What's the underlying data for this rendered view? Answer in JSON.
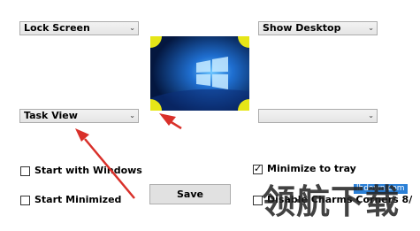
{
  "dropdowns": {
    "top_left": "Lock Screen",
    "top_right": "Show Desktop",
    "bottom_left": "Task View",
    "bottom_right": ""
  },
  "checkboxes": {
    "start_with_windows": {
      "label": "Start with Windows",
      "checked": false
    },
    "start_minimized": {
      "label": "Start Minimized",
      "checked": false
    },
    "minimize_to_tray": {
      "label": "Minimize to tray",
      "checked": true
    },
    "disable_charms": {
      "label": "Disable Charms Corners 8/",
      "checked": false
    }
  },
  "save_button": "Save",
  "watermark": {
    "url": "lhdown.com",
    "text": "领航下载"
  },
  "colors": {
    "corner": "#e6e617",
    "arrow": "#d9302a",
    "desktop": "#0a3a8c"
  }
}
